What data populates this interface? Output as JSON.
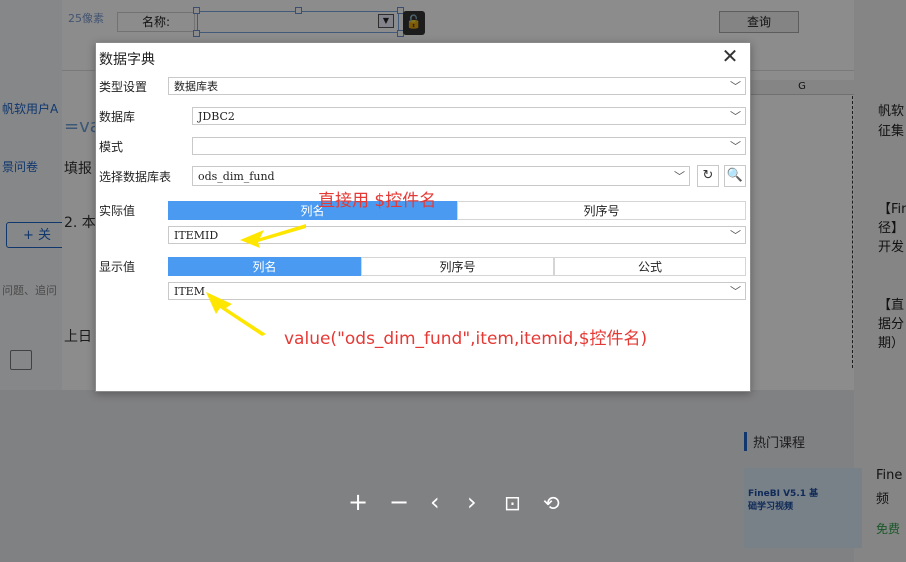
{
  "background": {
    "px_label": "25像素",
    "name_label": "名称:",
    "query_button": "查询",
    "left_items": [
      "帆软用户A",
      "景问卷",
      "关",
      "问题、追问"
    ],
    "sheet_cells": [
      "=va",
      "填报",
      "2. 本",
      "上日"
    ],
    "column_header": "G",
    "right_items": [
      "帆软",
      "征集",
      "【Fine",
      "径】",
      "开发",
      "【直",
      "据分",
      "期）"
    ],
    "hot_courses_title": "热门课程",
    "course_card_title": "FineBI V5.1 基础学习视频",
    "course_side": [
      "Fine",
      "频"
    ],
    "course_free": "免费"
  },
  "dialog": {
    "title": "数据字典",
    "rows": {
      "type": {
        "label": "类型设置",
        "value": "数据库表"
      },
      "database": {
        "label": "数据库",
        "value": "JDBC2"
      },
      "schema": {
        "label": "模式",
        "value": ""
      },
      "table": {
        "label": "选择数据库表",
        "value": "ods_dim_fund"
      },
      "actual": {
        "label": "实际值",
        "tabs": [
          "列名",
          "列序号"
        ],
        "value": "ITEMID"
      },
      "display": {
        "label": "显示值",
        "tabs": [
          "列名",
          "列序号",
          "公式"
        ],
        "value": "ITEM"
      }
    }
  },
  "annotations": {
    "note1": "直接用 $控件名",
    "note2": "value(\"ods_dim_fund\",item,itemid,$控件名)"
  },
  "colors": {
    "accent": "#4a9af1",
    "annotation": "#e53935",
    "arrow": "#ffe600"
  }
}
